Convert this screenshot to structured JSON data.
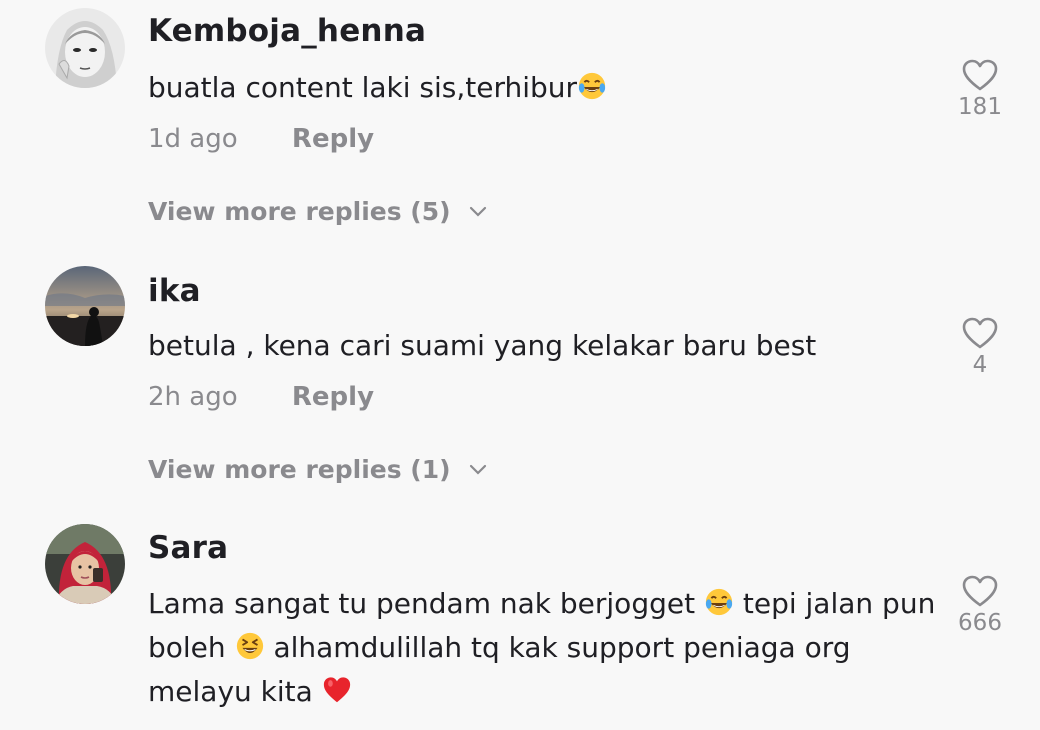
{
  "comments": [
    {
      "username": "Kemboja_henna",
      "text_parts": [
        "buatla content laki sis,terhibur"
      ],
      "timestamp": "1d ago",
      "reply_label": "Reply",
      "likes": "181",
      "view_more": "View more replies (5)"
    },
    {
      "username": "ika",
      "text_parts": [
        "betula , kena cari suami yang kelakar baru best"
      ],
      "timestamp": "2h ago",
      "reply_label": "Reply",
      "likes": "4",
      "view_more": "View more replies (1)"
    },
    {
      "username": "Sara",
      "text_parts": [
        "Lama sangat tu pendam nak berjogget ",
        " tepi jalan pun boleh ",
        " alhamdulillah tq kak support peniaga org melayu kita "
      ],
      "likes": "666"
    }
  ],
  "icons": {
    "like": "heart-outline-icon",
    "expand": "chevron-down-icon",
    "emoji_laugh": "face-with-tears-of-joy",
    "emoji_grin": "grinning-squinting-face",
    "emoji_heart": "red-heart"
  },
  "colors": {
    "background": "#f8f8f8",
    "text_primary": "#1f1f24",
    "text_secondary": "#8a8a8e",
    "heart_emoji": "#e8242c",
    "emoji_face": "#ffc83a"
  }
}
